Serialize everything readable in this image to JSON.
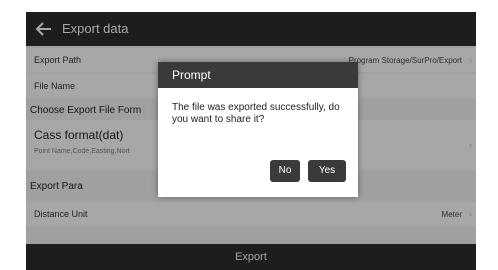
{
  "header": {
    "title": "Export data"
  },
  "rows": {
    "export_path": {
      "label": "Export Path",
      "value": "Program Storage/SurPro/Export"
    },
    "file_name": {
      "label": "File Name"
    },
    "section_format": "Choose Export File Form",
    "format_title": "Cass format(dat)",
    "format_fields": "Point Name,Code,Easting,Nort",
    "section_para": "Export Para",
    "distance_unit": {
      "label": "Distance Unit",
      "value": "Meter"
    }
  },
  "footer": {
    "export_label": "Export"
  },
  "dialog": {
    "title": "Prompt",
    "message": "The file was exported successfully, do you want to share it?",
    "no_label": "No",
    "yes_label": "Yes"
  },
  "colors": {
    "bar": "#2a2a2a",
    "dialog_header": "#3a3a3a",
    "background": "#e6e6e6"
  },
  "icons": {
    "back": "back-arrow-icon",
    "chevron": "chevron-right-icon"
  }
}
